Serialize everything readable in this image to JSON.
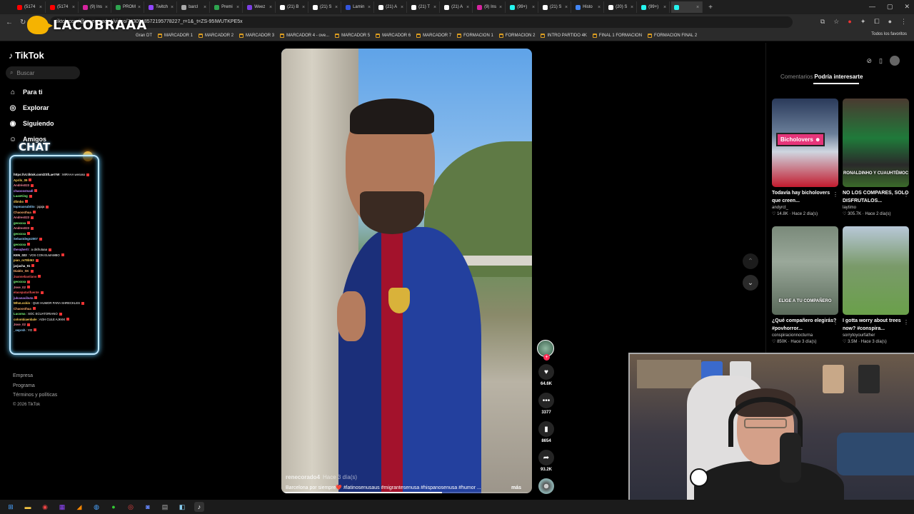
{
  "browser": {
    "tabs": [
      {
        "label": "(5174",
        "color": "#ff0000"
      },
      {
        "label": "(5174",
        "color": "#ff0000"
      },
      {
        "label": "(9) Ins",
        "color": "#d6249f"
      },
      {
        "label": "PROM",
        "color": "#2ea44f"
      },
      {
        "label": "Twitch",
        "color": "#9146ff"
      },
      {
        "label": "barcl",
        "color": "#aaaaaa"
      },
      {
        "label": "Premi",
        "color": "#2ea44f"
      },
      {
        "label": "Weez",
        "color": "#7b3fe4"
      },
      {
        "label": "(21) B",
        "color": "#ffffff"
      },
      {
        "label": "(21) S",
        "color": "#ffffff"
      },
      {
        "label": "Lamin",
        "color": "#3355dd"
      },
      {
        "label": "(21) A",
        "color": "#ffffff"
      },
      {
        "label": "(21) T",
        "color": "#ffffff"
      },
      {
        "label": "(21) A",
        "color": "#ffffff"
      },
      {
        "label": "(9) Ins",
        "color": "#d6249f"
      },
      {
        "label": "(99+)",
        "color": "#25f4ee"
      },
      {
        "label": "(21) S",
        "color": "#ffffff"
      },
      {
        "label": "Histo",
        "color": "#4285f4"
      },
      {
        "label": "(20) S",
        "color": "#ffffff"
      },
      {
        "label": "(99+)",
        "color": "#25f4ee"
      },
      {
        "label": "",
        "color": "#25f4ee"
      }
    ],
    "url": "tiktok.com/@renecorado4/video/7630518572195778227_r=1&_t=ZS-95IWUTKPE5x",
    "bookmarks": [
      "Gran DT",
      "MARCADOR 1",
      "MARCADOR 2",
      "MARCADOR 3",
      "MARCADOR 4 - ove...",
      "MARCADOR 5",
      "MARCADOR 6",
      "MARCADOR 7",
      "FORMACION 1",
      "FORMACION 2",
      "INTRO PARTIDO 4K",
      "FINAL 1 FORMACION",
      "FORMACION FINAL 2"
    ],
    "bookmarks_right": "Todos los favoritos"
  },
  "overlay": {
    "streamer_name": "LACOBRAAA",
    "chat_title": "CHAT"
  },
  "sidebar": {
    "logo": "TikTok",
    "search_placeholder": "Buscar",
    "nav": [
      {
        "label": "Para ti",
        "icon": "home-icon"
      },
      {
        "label": "Explorar",
        "icon": "compass-icon"
      },
      {
        "label": "Siguiendo",
        "icon": "following-icon"
      },
      {
        "label": "Amigos",
        "icon": "friends-icon"
      }
    ],
    "footer": [
      "Empresa",
      "Programa",
      "Términos y políticas",
      "© 2026 TikTok"
    ]
  },
  "chat": [
    {
      "user": "https://vt.tiktok.com/ZSfLae7rW",
      "msg": "MIRAAA wenaso",
      "color": "#ffffff"
    },
    {
      "user": "Aprils_09",
      "msg": "",
      "color": "#ffd35c"
    },
    {
      "user": "Andrés023",
      "msg": "",
      "color": "#ff8aa0"
    },
    {
      "user": "chaoosstsadl",
      "msg": "",
      "color": "#c28cff"
    },
    {
      "user": "LuanKing",
      "msg": "",
      "color": "#7fff7f"
    },
    {
      "user": "dlimbo",
      "msg": "",
      "color": "#ffd35c"
    },
    {
      "user": "topmaxsubtito",
      "msg": "jajaja",
      "color": "#8fd0ff"
    },
    {
      "user": "Chaoosthua",
      "msg": "",
      "color": "#ffb070"
    },
    {
      "user": "Andres023",
      "msg": "",
      "color": "#ff8aa0"
    },
    {
      "user": "geoxxxa",
      "msg": "",
      "color": "#7fff7f"
    },
    {
      "user": "Andres023",
      "msg": "",
      "color": "#ff8aa0"
    },
    {
      "user": "geoxxxa",
      "msg": "",
      "color": "#7fff7f"
    },
    {
      "user": "Sebastdegn2007",
      "msg": "",
      "color": "#8fd0ff"
    },
    {
      "user": "geoxxxa",
      "msg": "",
      "color": "#7fff7f"
    },
    {
      "user": "thesqhertt",
      "msg": "a disfrutaaa",
      "color": "#c28cff"
    },
    {
      "user": "KEN_022",
      "msg": "VOS CON ELMAMBO",
      "color": "#ffffff"
    },
    {
      "user": "pian_m78bt63",
      "msg": "",
      "color": "#ffd35c"
    },
    {
      "user": "jarjacha_91",
      "msg": "",
      "color": "#ffffff"
    },
    {
      "user": "Diablo_SK",
      "msg": "",
      "color": "#ffb070"
    },
    {
      "user": "Juansebastiano",
      "msg": "",
      "color": "#ff5c5c"
    },
    {
      "user": "geoxxxa",
      "msg": "",
      "color": "#7fff7f"
    },
    {
      "user": "Jose_02",
      "msg": "",
      "color": "#ff8aa0"
    },
    {
      "user": "elaceputarifuente",
      "msg": "",
      "color": "#ff5c5c"
    },
    {
      "user": "julcanacibuta",
      "msg": "",
      "color": "#c28cff"
    },
    {
      "user": "WhoLockin",
      "msg": "QUE HUMOR PARA SHRECKLES",
      "color": "#ffd35c"
    },
    {
      "user": "Chaoosthua",
      "msg": "",
      "color": "#ffb070"
    },
    {
      "user": "Lucoma",
      "msg": "SOC ECUATORIANO",
      "color": "#7fff7f"
    },
    {
      "user": "colombiaenbale",
      "msg": "AGH CULE AJKKK",
      "color": "#ffd35c"
    },
    {
      "user": "Jose_02",
      "msg": "",
      "color": "#ff8aa0"
    },
    {
      "user": "_seprsh",
      "msg": "YO",
      "color": "#8fd0ff"
    }
  ],
  "video": {
    "author": "renecorado4",
    "time": "Hace 3 día(s)",
    "caption": "Barcelona por siempre❤️ #latinosenusaus #migrantesenusa #hispanosenusa #humor ...",
    "more": "más",
    "progress": 0.64,
    "likes": "64.6K",
    "comments": "3377",
    "saves": "8654",
    "shares": "93.2K"
  },
  "right_panel": {
    "tabs": [
      "Comentarios",
      "Podría interesarte"
    ],
    "active_tab": 1,
    "cards": [
      {
        "title": "Todavía hay bicholovers que creen...",
        "author": "andyrct_",
        "likes": "14.8K",
        "time": "Hace 2 día(s)",
        "badge": "Bicholovers ☻",
        "thumb_label": "",
        "bg": "linear-gradient(180deg,#2a3a5a 0%,#6b7f9a 40%,#cfd6e0 60%,#c21b2e 100%)"
      },
      {
        "title": "NO LOS COMPARES, SOLO DISFRUTALOS...",
        "author": "laytimo",
        "likes": "305.7K",
        "time": "Hace 2 día(s)",
        "badge": "",
        "thumb_label": "RONALDINHO Y CUAUHTÉMOC",
        "bg": "linear-gradient(180deg,#4a3a30 0%,#1f7a3a 45%,#2a2a2a 75%,#3a6a2a 100%)"
      },
      {
        "title": "¿Qué compañero elegirás? #povhorror...",
        "author": "conspiracionnocturna",
        "likes": "850K",
        "time": "Hace 3 día(s)",
        "badge": "",
        "thumb_label": "ELIGE A TU COMPAÑERO",
        "bg": "linear-gradient(180deg,#7a8a7a 0%,#9aa89a 40%,#5a6a5a 100%)"
      },
      {
        "title": "I gotta worry about trees now? #conspira...",
        "author": "sorrytoyourfather",
        "likes": "3.5M",
        "time": "Hace 3 día(s)",
        "badge": "",
        "thumb_label": "",
        "bg": "linear-gradient(180deg,#b8c8d8 0%,#7a9a6a 45%,#6aa04a 100%)"
      }
    ]
  },
  "colors": {
    "accent": "#fe2c55",
    "chat_border": "#bfe8ff"
  }
}
